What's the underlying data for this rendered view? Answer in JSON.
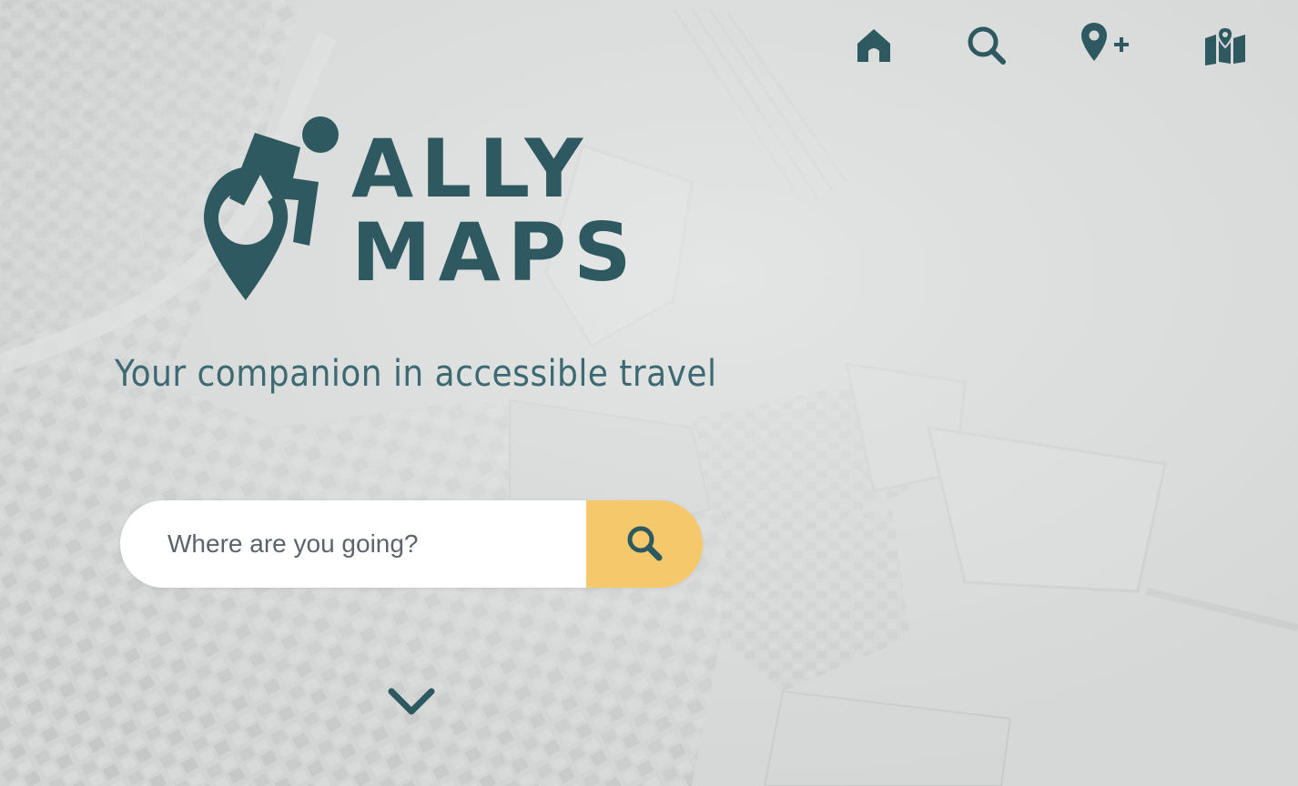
{
  "nav": {
    "items": [
      {
        "icon": "home-icon"
      },
      {
        "icon": "search-icon"
      },
      {
        "icon": "add-location-icon"
      },
      {
        "icon": "map-icon"
      }
    ]
  },
  "logo": {
    "line1": "ALLY",
    "line2": "MAPS",
    "icon": "wheelchair-location-pin-icon"
  },
  "tagline": "Your companion in accessible travel",
  "search": {
    "placeholder": "Where are you going?",
    "button_icon": "search-icon"
  },
  "scroll_icon": "chevron-down-icon",
  "colors": {
    "brand": "#2e5961",
    "accent": "#f5c96b",
    "input_bg": "#ffffff"
  }
}
